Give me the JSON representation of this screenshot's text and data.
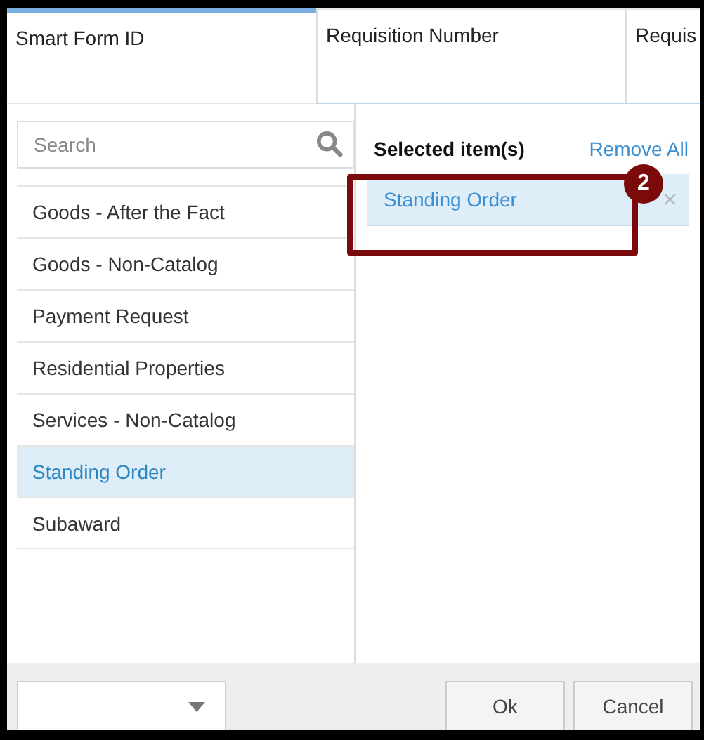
{
  "tabs": [
    {
      "label": "Smart Form ID",
      "selected": true
    },
    {
      "label": "Requisition Number",
      "selected": false
    },
    {
      "label": "Requis",
      "selected": false
    }
  ],
  "search": {
    "placeholder": "Search"
  },
  "options": [
    {
      "label": "Goods - After the Fact",
      "selected": false
    },
    {
      "label": "Goods - Non-Catalog",
      "selected": false
    },
    {
      "label": "Payment Request",
      "selected": false
    },
    {
      "label": "Residential Properties",
      "selected": false
    },
    {
      "label": "Services - Non-Catalog",
      "selected": false
    },
    {
      "label": "Standing Order",
      "selected": true
    },
    {
      "label": "Subaward",
      "selected": false
    }
  ],
  "selected_panel": {
    "title": "Selected item(s)",
    "remove_all": "Remove All",
    "items": [
      {
        "label": "Standing Order",
        "remove": "×"
      }
    ]
  },
  "annotation": {
    "number": "2"
  },
  "buttons": [
    "Ok",
    "Cancel"
  ]
}
